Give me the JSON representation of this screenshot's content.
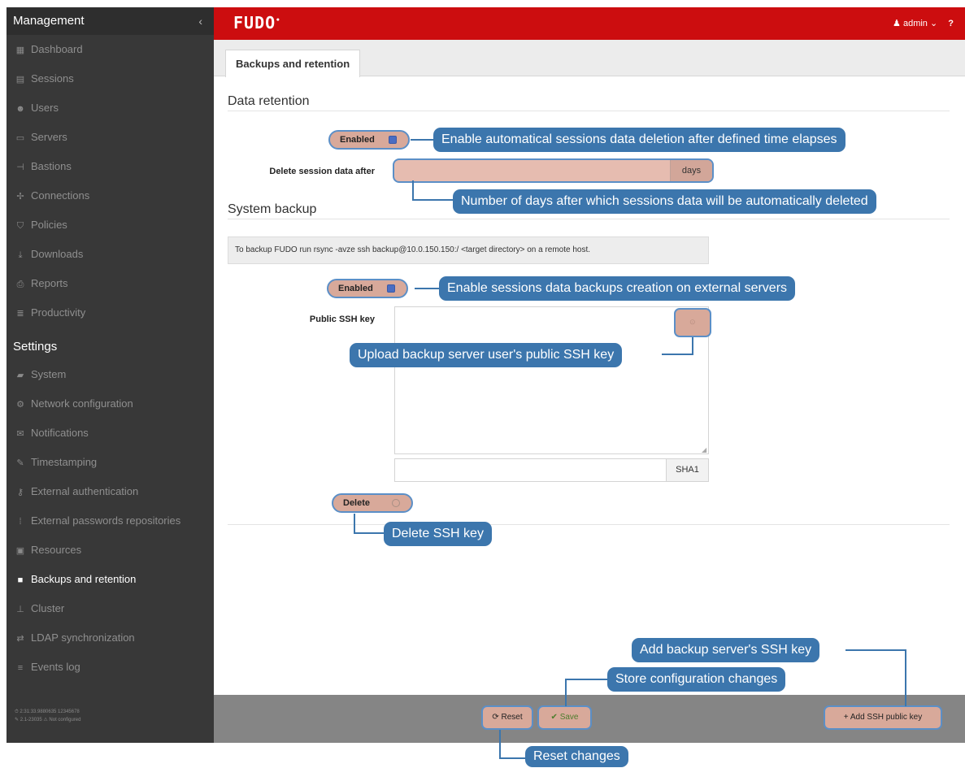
{
  "sidebar": {
    "management_title": "Management",
    "collapse_icon": "chevron-left-icon",
    "management_items": [
      {
        "label": "Dashboard",
        "icon": "dashboard-icon"
      },
      {
        "label": "Sessions",
        "icon": "sessions-icon"
      },
      {
        "label": "Users",
        "icon": "users-icon"
      },
      {
        "label": "Servers",
        "icon": "servers-icon"
      },
      {
        "label": "Bastions",
        "icon": "bastions-icon"
      },
      {
        "label": "Connections",
        "icon": "connections-icon"
      },
      {
        "label": "Policies",
        "icon": "shield-icon"
      },
      {
        "label": "Downloads",
        "icon": "download-icon"
      },
      {
        "label": "Reports",
        "icon": "reports-icon"
      },
      {
        "label": "Productivity",
        "icon": "productivity-icon"
      }
    ],
    "settings_title": "Settings",
    "settings_items": [
      {
        "label": "System",
        "icon": "folder-icon"
      },
      {
        "label": "Network configuration",
        "icon": "cogs-icon"
      },
      {
        "label": "Notifications",
        "icon": "envelope-icon"
      },
      {
        "label": "Timestamping",
        "icon": "edit-icon"
      },
      {
        "label": "External authentication",
        "icon": "key-icon"
      },
      {
        "label": "External passwords repositories",
        "icon": "grid-icon"
      },
      {
        "label": "Resources",
        "icon": "image-icon"
      },
      {
        "label": "Backups and retention",
        "icon": "archive-icon",
        "active": true
      },
      {
        "label": "Cluster",
        "icon": "sitemap-icon"
      },
      {
        "label": "LDAP synchronization",
        "icon": "exchange-icon"
      },
      {
        "label": "Events log",
        "icon": "list-icon"
      }
    ],
    "footer_line1": "⏱ 2:31:33.9880635 12345678",
    "footer_line2": "✎ 2.1-23035    ⚠ Not configured"
  },
  "topbar": {
    "logo": "FUDO",
    "user_label": "admin",
    "help_label": "?"
  },
  "tab": {
    "label": "Backups and retention"
  },
  "retention": {
    "section_title": "Data retention",
    "enabled_label": "Enabled",
    "enabled_checked": true,
    "delete_after_label": "Delete session data after",
    "delete_after_value": "",
    "days_addon": "days"
  },
  "backup": {
    "section_title": "System backup",
    "info_text": "To backup FUDO run rsync -avze ssh backup@10.0.150.150:/ <target directory> on a remote host.",
    "enabled_label": "Enabled",
    "enabled_checked": true,
    "public_key_label": "Public SSH key",
    "sha_value": "",
    "sha_addon": "SHA1",
    "delete_label": "Delete",
    "delete_checked": false
  },
  "callouts": {
    "enable_retention": "Enable automatical sessions data deletion after defined time elapses",
    "days_info": "Number of days after which sessions data will be automatically deleted",
    "enable_backups": "Enable sessions data backups creation on external servers",
    "upload_key": "Upload backup server user's public SSH key",
    "delete_key": "Delete SSH key",
    "add_key": "Add backup server's SSH key",
    "store_changes": "Store configuration changes",
    "reset_changes": "Reset changes"
  },
  "footer": {
    "reset_label": "Reset",
    "save_label": "Save",
    "add_key_label": "+ Add SSH public key"
  },
  "colors": {
    "topbar": "#cc0d0f",
    "sidebar": "#383838",
    "callout": "#3c76ad",
    "highlight": "#d8a99a"
  }
}
